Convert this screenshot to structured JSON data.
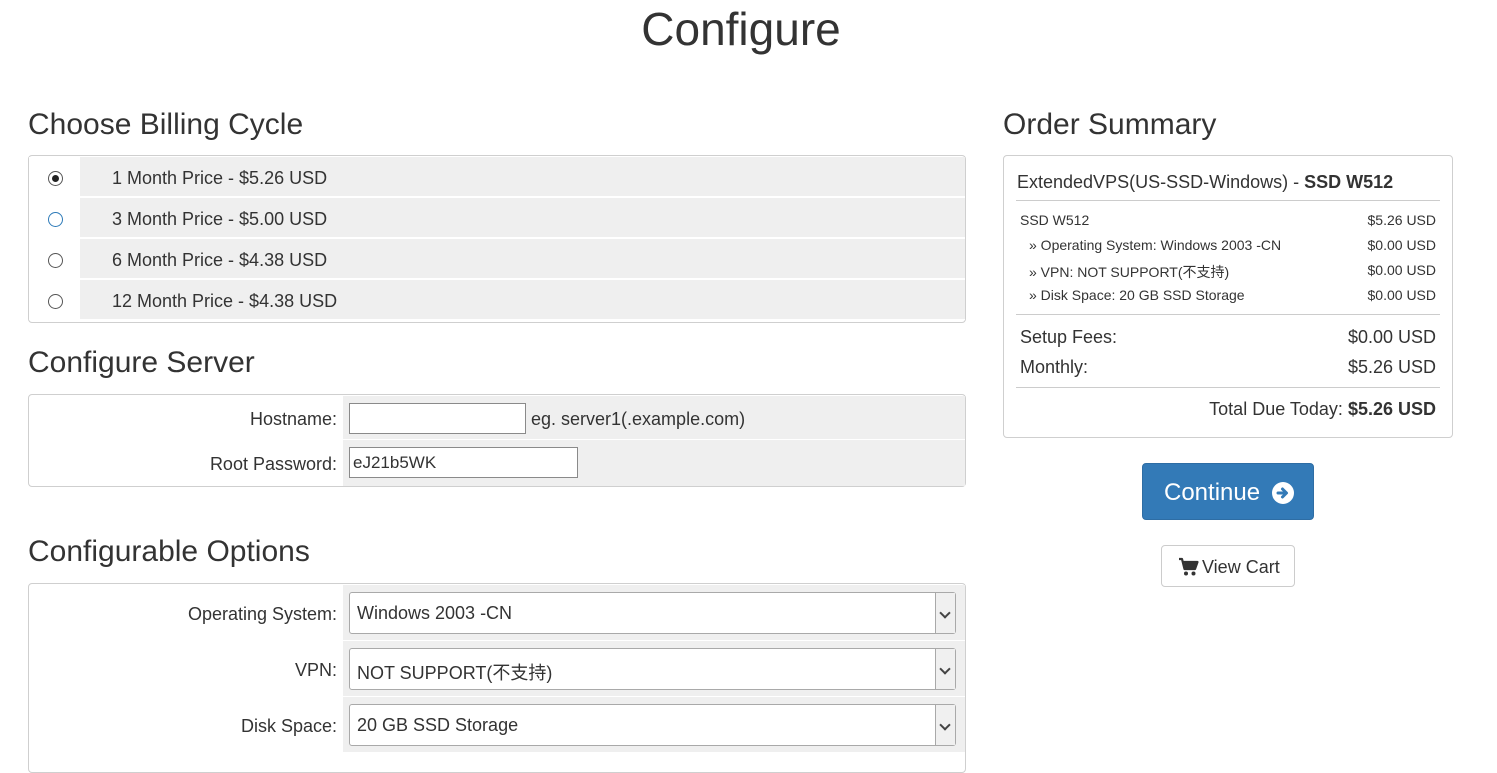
{
  "page": {
    "title": "Configure"
  },
  "billing": {
    "title": "Choose Billing Cycle",
    "options": [
      {
        "label": "1 Month Price - $5.26 USD",
        "checked": true
      },
      {
        "label": "3 Month Price - $5.00 USD",
        "checked": false
      },
      {
        "label": "6 Month Price - $4.38 USD",
        "checked": false
      },
      {
        "label": "12 Month Price - $4.38 USD",
        "checked": false
      }
    ]
  },
  "server": {
    "title": "Configure Server",
    "hostname_label": "Hostname:",
    "hostname_value": "",
    "hostname_hint": "eg. server1(.example.com)",
    "password_label": "Root Password:",
    "password_value": "eJ21b5WK"
  },
  "options": {
    "title": "Configurable Options",
    "os_label": "Operating System:",
    "os_value": "Windows 2003 -CN",
    "vpn_label": "VPN:",
    "vpn_value": "NOT SUPPORT(不支持)",
    "disk_label": "Disk Space:",
    "disk_value": "20 GB SSD Storage"
  },
  "summary": {
    "title": "Order Summary",
    "product_group": "ExtendedVPS(US-SSD-Windows) - ",
    "product_name": "SSD W512",
    "items": [
      {
        "label": "SSD W512",
        "amount": "$5.26 USD"
      },
      {
        "label": "» Operating System: Windows 2003 -CN",
        "amount": "$0.00 USD"
      },
      {
        "label": "» VPN: NOT SUPPORT(不支持)",
        "amount": "$0.00 USD"
      },
      {
        "label": "» Disk Space: 20 GB SSD Storage",
        "amount": "$0.00 USD"
      }
    ],
    "setup_label": "Setup Fees:",
    "setup_amount": "$0.00 USD",
    "monthly_label": "Monthly:",
    "monthly_amount": "$5.26 USD",
    "due_label": "Total Due Today: ",
    "due_amount": "$5.26 USD"
  },
  "actions": {
    "continue_label": "Continue",
    "viewcart_label": "View Cart"
  },
  "colors": {
    "primary": "#337ab7",
    "row_bg": "#efefef",
    "border": "#cfcfcf"
  },
  "icons": {
    "continue": "arrow-circle-right-icon",
    "cart": "shopping-cart-icon"
  }
}
